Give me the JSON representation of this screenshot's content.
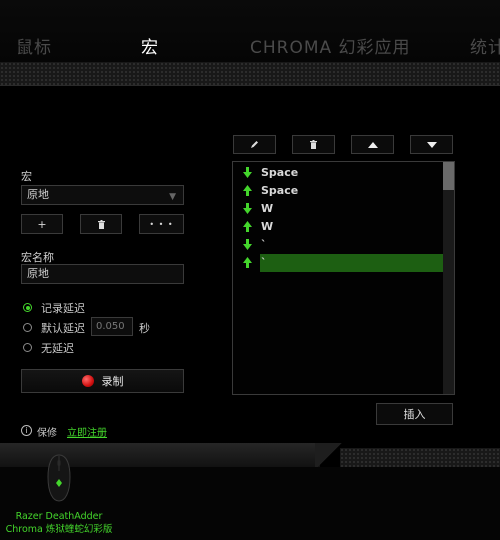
{
  "tabs": [
    {
      "label": "鼠标"
    },
    {
      "label": "宏"
    },
    {
      "label": "CHROMA 幻彩应用"
    },
    {
      "label": "统计"
    }
  ],
  "macro": {
    "section_label": "宏",
    "selected_macro": "原地",
    "add_label": "+",
    "more_label": "• • •",
    "name_label": "宏名称",
    "name_value": "原地"
  },
  "delay_options": [
    {
      "label": "记录延迟",
      "selected": true
    },
    {
      "label": "默认延迟",
      "selected": false
    },
    {
      "label": "无延迟",
      "selected": false
    }
  ],
  "default_delay": {
    "value": "0.050",
    "unit": "秒"
  },
  "record_label": "录制",
  "footer_info": {
    "text": "保修",
    "link": "立即注册"
  },
  "macro_events": [
    {
      "direction": "down",
      "key": "Space",
      "selected": false
    },
    {
      "direction": "up",
      "key": "Space",
      "selected": false
    },
    {
      "direction": "down",
      "key": "W",
      "selected": false
    },
    {
      "direction": "up",
      "key": "W",
      "selected": false
    },
    {
      "direction": "down",
      "key": "`",
      "selected": false
    },
    {
      "direction": "up",
      "key": "`",
      "selected": true
    }
  ],
  "insert_label": "插入",
  "device": {
    "line1": "Razer DeathAdder",
    "line2": "Chroma 炼狱蝰蛇幻彩版"
  },
  "colors": {
    "accent": "#44d62c",
    "selection": "#1d5f12",
    "record": "#e01a1a"
  }
}
